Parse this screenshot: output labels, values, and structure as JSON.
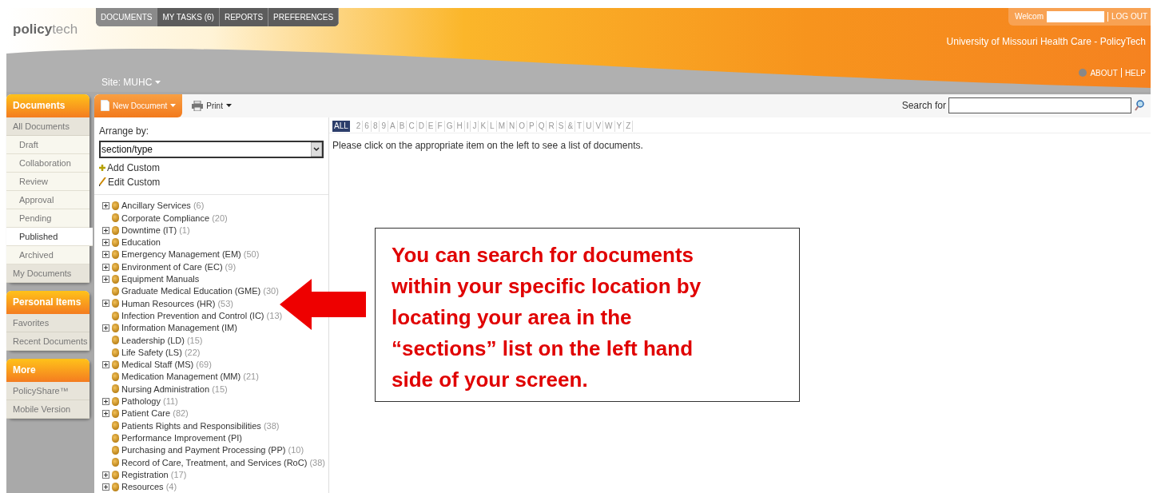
{
  "logo": {
    "part_1": "policy",
    "part_2": "tech"
  },
  "nav_tabs": [
    {
      "label": "DOCUMENTS",
      "selected": true
    },
    {
      "label": "MY TASKS (6)",
      "selected": false
    },
    {
      "label": "REPORTS",
      "selected": false
    },
    {
      "label": "PREFERENCES",
      "selected": false
    }
  ],
  "site": "Site: MUHC",
  "user_bar": {
    "welcome": "Welcom",
    "logout": "LOG OUT"
  },
  "org_title": "University of Missouri Health Care - PolicyTech",
  "help_links": [
    "ABOUT",
    "HELP"
  ],
  "sidebar": [
    {
      "title": "Documents",
      "items": [
        {
          "label": "All Documents",
          "selected": false,
          "children": [
            {
              "label": "Draft",
              "selected": false
            },
            {
              "label": "Collaboration",
              "selected": false
            },
            {
              "label": "Review",
              "selected": false
            },
            {
              "label": "Approval",
              "selected": false
            },
            {
              "label": "Pending",
              "selected": false
            },
            {
              "label": "Published",
              "selected": true
            },
            {
              "label": "Archived",
              "selected": false
            }
          ]
        },
        {
          "label": "My Documents",
          "selected": false
        }
      ]
    },
    {
      "title": "Personal Items",
      "items": [
        {
          "label": "Favorites",
          "selected": false
        },
        {
          "label": "Recent Documents",
          "selected": false
        }
      ]
    },
    {
      "title": "More",
      "items": [
        {
          "label": "PolicyShare™",
          "selected": false
        },
        {
          "label": "Mobile Version",
          "selected": false
        }
      ]
    }
  ],
  "toolbar": {
    "new_document": "New Document",
    "print": "Print",
    "search_label": "Search for"
  },
  "arrange": {
    "label": "Arrange by:",
    "value": "section/type",
    "add_custom": "Add Custom",
    "edit_custom": "Edit Custom"
  },
  "sections": [
    {
      "label": "Ancillary Services",
      "count": "(6)",
      "expandable": true
    },
    {
      "label": "Corporate Compliance",
      "count": "(20)",
      "expandable": false
    },
    {
      "label": "Downtime (IT)",
      "count": "(1)",
      "expandable": true
    },
    {
      "label": "Education",
      "expandable": true
    },
    {
      "label": "Emergency Management (EM)",
      "count": "(50)",
      "expandable": true
    },
    {
      "label": "Environment of Care (EC)",
      "count": "(9)",
      "expandable": true
    },
    {
      "label": "Equipment Manuals",
      "expandable": true
    },
    {
      "label": "Graduate Medical Education (GME)",
      "count": "(30)",
      "expandable": false
    },
    {
      "label": "Human Resources (HR)",
      "count": "(53)",
      "expandable": true
    },
    {
      "label": "Infection Prevention and Control (IC)",
      "count": "(13)",
      "expandable": false
    },
    {
      "label": "Information Management (IM)",
      "expandable": true
    },
    {
      "label": "Leadership (LD)",
      "count": "(15)",
      "expandable": false
    },
    {
      "label": "Life Safety (LS)",
      "count": "(22)",
      "expandable": false
    },
    {
      "label": "Medical Staff (MS)",
      "count": "(69)",
      "expandable": true
    },
    {
      "label": "Medication Management (MM)",
      "count": "(21)",
      "expandable": false
    },
    {
      "label": "Nursing Administration",
      "count": "(15)",
      "expandable": false
    },
    {
      "label": "Pathology",
      "count": "(11)",
      "expandable": true
    },
    {
      "label": "Patient Care",
      "count": "(82)",
      "expandable": true
    },
    {
      "label": "Patients Rights and Responsibilities",
      "count": "(38)",
      "expandable": false
    },
    {
      "label": "Performance Improvement (PI)",
      "expandable": false
    },
    {
      "label": "Purchasing and Payment Processing (PP)",
      "count": "(10)",
      "expandable": false
    },
    {
      "label": "Record of Care, Treatment, and Services (RoC)",
      "count": "(38)",
      "expandable": false
    },
    {
      "label": "Registration",
      "count": "(17)",
      "expandable": true
    },
    {
      "label": "Resources",
      "count": "(4)",
      "expandable": true
    }
  ],
  "letters": [
    {
      "label": "ALL",
      "selected": true
    },
    {
      "label": "2",
      "selected": false
    },
    {
      "label": "6",
      "selected": false
    },
    {
      "label": "8",
      "selected": false
    },
    {
      "label": "9",
      "selected": false
    },
    {
      "label": "A",
      "selected": false
    },
    {
      "label": "B",
      "selected": false
    },
    {
      "label": "C",
      "selected": false
    },
    {
      "label": "D",
      "selected": false
    },
    {
      "label": "E",
      "selected": false
    },
    {
      "label": "F",
      "selected": false
    },
    {
      "label": "G",
      "selected": false
    },
    {
      "label": "H",
      "selected": false
    },
    {
      "label": "I",
      "selected": false
    },
    {
      "label": "J",
      "selected": false
    },
    {
      "label": "K",
      "selected": false
    },
    {
      "label": "L",
      "selected": false
    },
    {
      "label": "M",
      "selected": false
    },
    {
      "label": "N",
      "selected": false
    },
    {
      "label": "O",
      "selected": false
    },
    {
      "label": "P",
      "selected": false
    },
    {
      "label": "Q",
      "selected": false
    },
    {
      "label": "R",
      "selected": false
    },
    {
      "label": "S",
      "selected": false
    },
    {
      "label": "&",
      "selected": false
    },
    {
      "label": "T",
      "selected": false
    },
    {
      "label": "U",
      "selected": false
    },
    {
      "label": "V",
      "selected": false
    },
    {
      "label": "W",
      "selected": false
    },
    {
      "label": "Y",
      "selected": false
    },
    {
      "label": "Z",
      "selected": false
    }
  ],
  "message": "Please click on the appropriate item on the left to see a list of documents.",
  "callout": "You can search for documents within your specific location by locating your area in the “sections” list on the left hand side of your screen."
}
